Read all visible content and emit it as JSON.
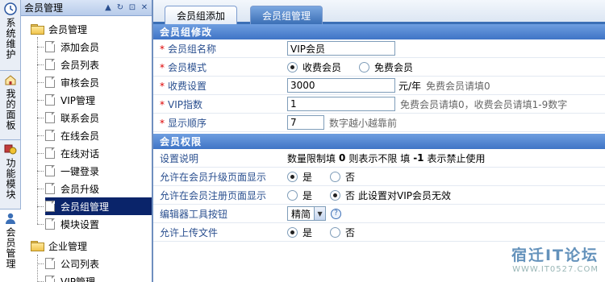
{
  "rail": {
    "items": [
      {
        "label": "系统维护",
        "icon": "clock-icon"
      },
      {
        "label": "我的面板",
        "icon": "home-icon"
      },
      {
        "label": "功能模块",
        "icon": "modules-icon"
      },
      {
        "label": "会员管理",
        "icon": "user-icon"
      }
    ]
  },
  "tree": {
    "title": "会员管理",
    "groups": [
      {
        "label": "会员管理",
        "items": [
          "添加会员",
          "会员列表",
          "审核会员",
          "VIP管理",
          "联系会员",
          "在线会员",
          "在线对话",
          "一键登录",
          "会员升级",
          "会员组管理",
          "模块设置"
        ]
      },
      {
        "label": "企业管理",
        "items": [
          "公司列表",
          "VIP管理"
        ]
      }
    ]
  },
  "tabs": [
    {
      "label": "会员组添加",
      "active": false
    },
    {
      "label": "会员组管理",
      "active": true
    }
  ],
  "edit_section": {
    "title": "会员组修改",
    "group_name": {
      "label": "会员组名称",
      "value": "VIP会员"
    },
    "mode": {
      "label": "会员模式",
      "options": [
        "收费会员",
        "免费会员"
      ],
      "selected": "收费会员"
    },
    "fee": {
      "label": "收费设置",
      "value": "3000",
      "unit": "元/年",
      "hint": "免费会员请填0"
    },
    "vip_index": {
      "label": "VIP指数",
      "value": "1",
      "hint": "免费会员请填0，收费会员请填1-9数字"
    },
    "order": {
      "label": "显示顺序",
      "value": "7",
      "hint": "数字越小越靠前"
    }
  },
  "perm_section": {
    "title": "会员权限",
    "note": {
      "label": "设置说明",
      "text_a": "数量限制填",
      "zero": "0",
      "text_b": "则表示不限  填",
      "minus_one": "-1",
      "text_c": "表示禁止使用"
    },
    "upgrade_page": {
      "label": "允许在会员升级页面显示",
      "options": [
        "是",
        "否"
      ],
      "selected": "是"
    },
    "register_page": {
      "label": "允许在会员注册页面显示",
      "options": [
        "是",
        "否"
      ],
      "selected": "否",
      "hint": "此设置对VIP会员无效"
    },
    "editor": {
      "label": "编辑器工具按钮",
      "value": "精简"
    },
    "upload": {
      "label": "允许上传文件",
      "options": [
        "是",
        "否"
      ],
      "selected": "是"
    }
  },
  "watermark": {
    "line1": "宿迁IT论坛",
    "line2": "WWW.IT0527.COM"
  },
  "colors": {
    "accent": "#3b6fb6",
    "tree_selected": "#0a246a",
    "required": "#dd0000"
  }
}
